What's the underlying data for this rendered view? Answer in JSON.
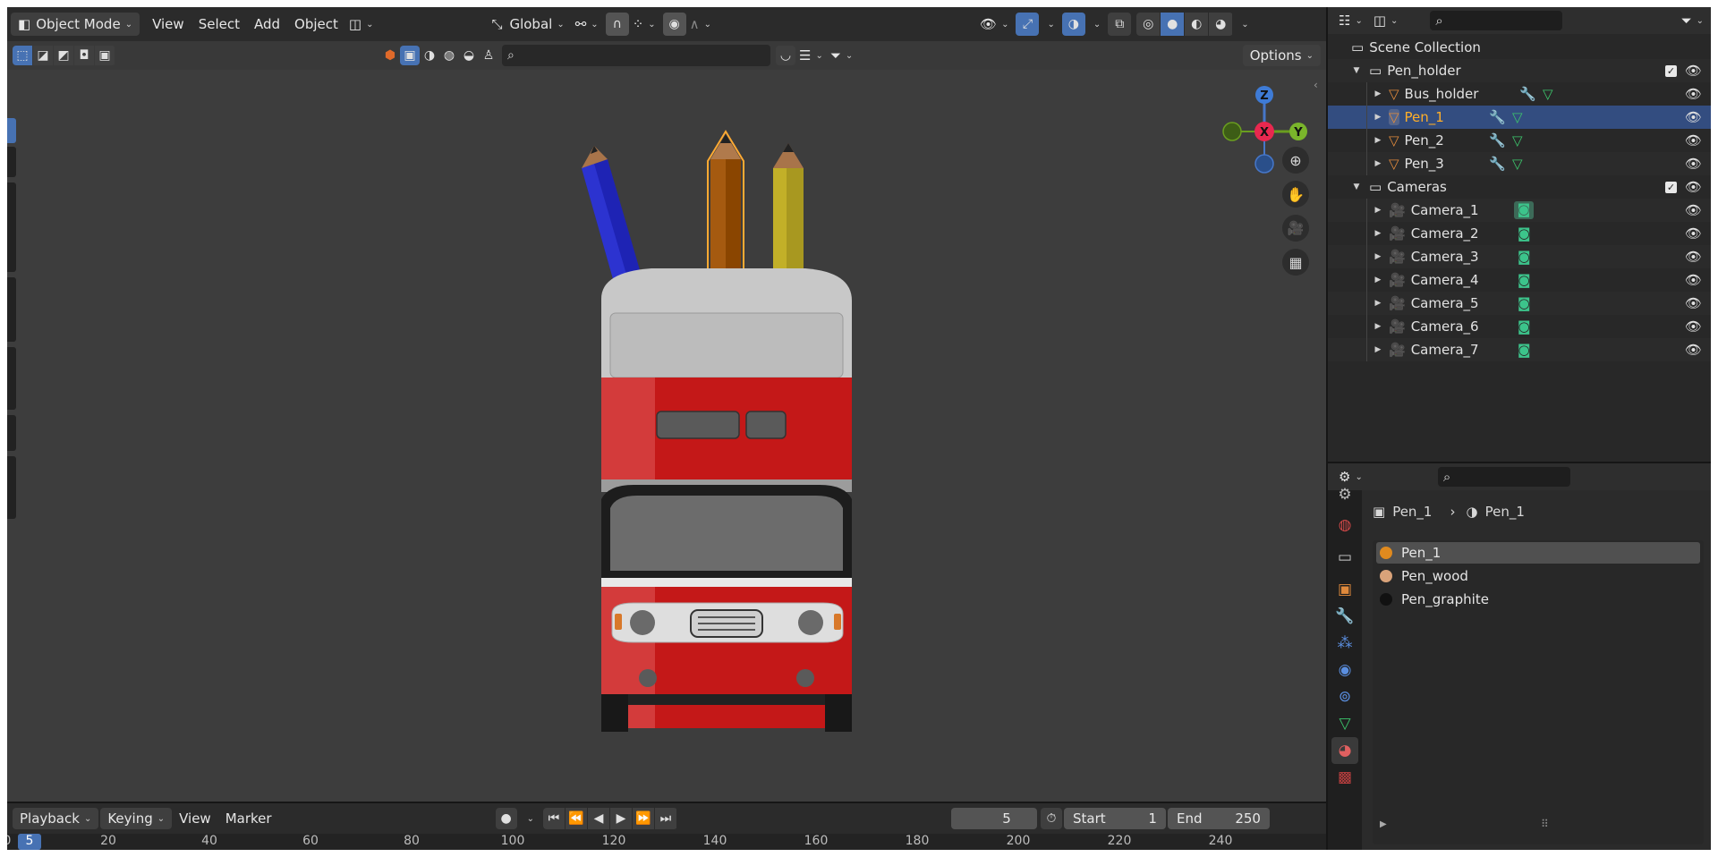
{
  "header": {
    "mode": "Object Mode",
    "menus": [
      "View",
      "Select",
      "Add",
      "Object"
    ],
    "transform_orientation": "Global",
    "options_label": "Options"
  },
  "viewport": {
    "gizmo_axes": {
      "z": "Z",
      "x": "X",
      "y": "Y"
    },
    "search_placeholder": ""
  },
  "outliner": {
    "search_placeholder": "",
    "scene_collection": "Scene Collection",
    "items": [
      {
        "label": "Pen_holder",
        "type": "collection",
        "depth": 1
      },
      {
        "label": "Bus_holder",
        "type": "mesh",
        "depth": 2
      },
      {
        "label": "Pen_1",
        "type": "mesh",
        "depth": 2,
        "selected": true
      },
      {
        "label": "Pen_2",
        "type": "mesh",
        "depth": 2
      },
      {
        "label": "Pen_3",
        "type": "mesh",
        "depth": 2
      },
      {
        "label": "Cameras",
        "type": "collection",
        "depth": 1
      },
      {
        "label": "Camera_1",
        "type": "camera",
        "depth": 2
      },
      {
        "label": "Camera_2",
        "type": "camera",
        "depth": 2
      },
      {
        "label": "Camera_3",
        "type": "camera",
        "depth": 2
      },
      {
        "label": "Camera_4",
        "type": "camera",
        "depth": 2
      },
      {
        "label": "Camera_5",
        "type": "camera",
        "depth": 2
      },
      {
        "label": "Camera_6",
        "type": "camera",
        "depth": 2
      },
      {
        "label": "Camera_7",
        "type": "camera",
        "depth": 2
      }
    ]
  },
  "properties": {
    "breadcrumb": {
      "object": "Pen_1",
      "material": "Pen_1"
    },
    "material_slots": [
      {
        "label": "Pen_1",
        "color": "#e08a1e",
        "selected": true
      },
      {
        "label": "Pen_wood",
        "color": "#d9a37a"
      },
      {
        "label": "Pen_graphite",
        "color": "#111111"
      }
    ]
  },
  "timeline": {
    "menus": [
      "Playback",
      "Keying",
      "View",
      "Marker"
    ],
    "current_frame": "5",
    "start_label": "Start",
    "start_value": "1",
    "end_label": "End",
    "end_value": "250",
    "ruler_current": "5",
    "ruler_ticks": [
      "0",
      "20",
      "40",
      "60",
      "80",
      "100",
      "120",
      "140",
      "160",
      "180",
      "200",
      "220",
      "240"
    ]
  },
  "colors": {
    "selection": "#334d80",
    "active_object": "#ffaf29",
    "accent_blue": "#4772b3"
  }
}
